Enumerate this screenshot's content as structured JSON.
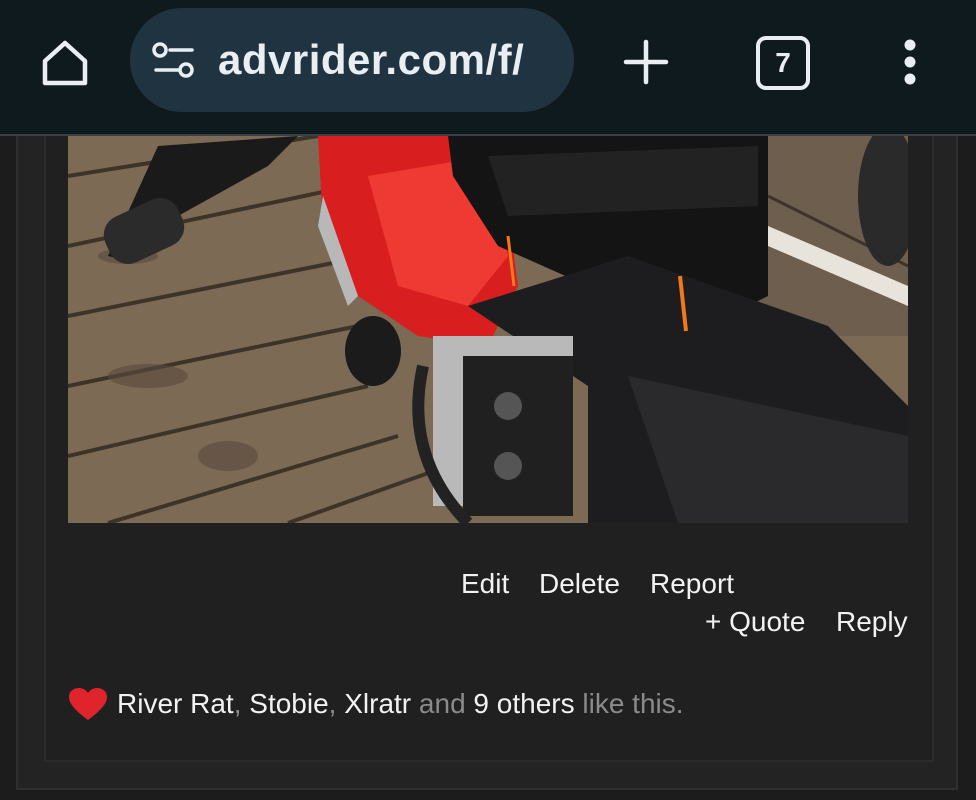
{
  "browser": {
    "url": "advrider.com/f/",
    "tab_count": "7",
    "icons": {
      "home": "home-icon",
      "site_settings": "tune-icon",
      "new_tab": "plus-icon",
      "tabs": "tab-switcher-icon",
      "menu": "more-vert-icon"
    }
  },
  "post": {
    "image_description_icon": "motorcycle-photo",
    "actions": {
      "edit": "Edit",
      "delete": "Delete",
      "report": "Report",
      "quote": "+ Quote",
      "reply": "Reply"
    },
    "likes": {
      "names": [
        "River Rat",
        "Stobie",
        "Xlratr"
      ],
      "sep1": ", ",
      "sep2": ", ",
      "and": " and ",
      "others": "9 others",
      "suffix": " like this.",
      "heart_color": "#e0242b"
    }
  },
  "colors": {
    "toolbar_bg": "#0f1a1f",
    "urlbar_bg": "#1f3440",
    "page_bg": "#1c1c1c",
    "text": "#f2f2f2",
    "muted": "#8a8a8a"
  }
}
